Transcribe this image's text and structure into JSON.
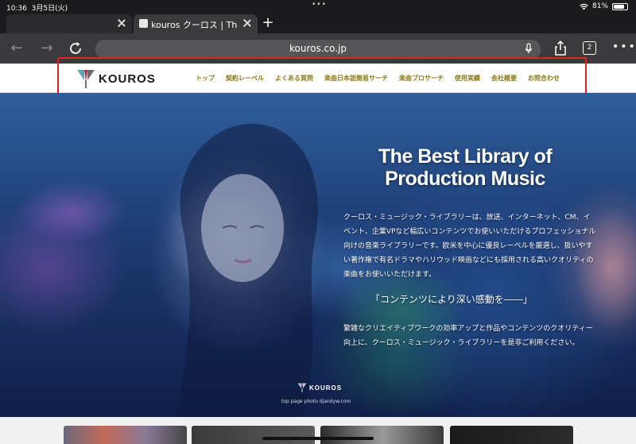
{
  "status_bar": {
    "time": "10:36",
    "date": "3月5日(火)",
    "battery": "81%",
    "battery_level": 0.81
  },
  "tabs": [
    {
      "title": ""
    },
    {
      "title": "kouros クーロス | The Best Library of Production Music"
    }
  ],
  "toolbar": {
    "url": "kouros.co.jp",
    "tab_count": "2"
  },
  "site": {
    "logo": "KOUROS",
    "nav": [
      "トップ",
      "契約レーベル",
      "よくある質問",
      "楽曲日本語簡易サーチ",
      "楽曲プロサーチ",
      "使用実績",
      "会社概要",
      "お問合わせ"
    ]
  },
  "hero": {
    "title_line1": "The Best Library of",
    "title_line2": "Production Music",
    "description": "クーロス・ミュージック・ライブラリーは、放送、インターネット、CM、イベント、企業VPなど幅広いコンテンツでお使いいただけるプロフェッショナル向けの音楽ライブラリーです。欧米を中心に優良レーベルを厳選し、扱いやすい著作権で有名ドラマやハリウッド映画などにも採用される高いクオリティの楽曲をお使いいただけます。",
    "catch": "「コンテンツにより深い感動を――」",
    "description2": "繁雑なクリエイティブワークの効率アップと作品やコンテンツのクオリティー向上に、クーロス・ミュージック・ライブラリーを是非ご利用ください。",
    "logo": "KOUROS",
    "photo_credit": "top page photo djandyw.com"
  },
  "colors": {
    "nav_text": "#8a7a16",
    "highlight": "#e0202a",
    "browser_bg": "#1b1b1d"
  }
}
